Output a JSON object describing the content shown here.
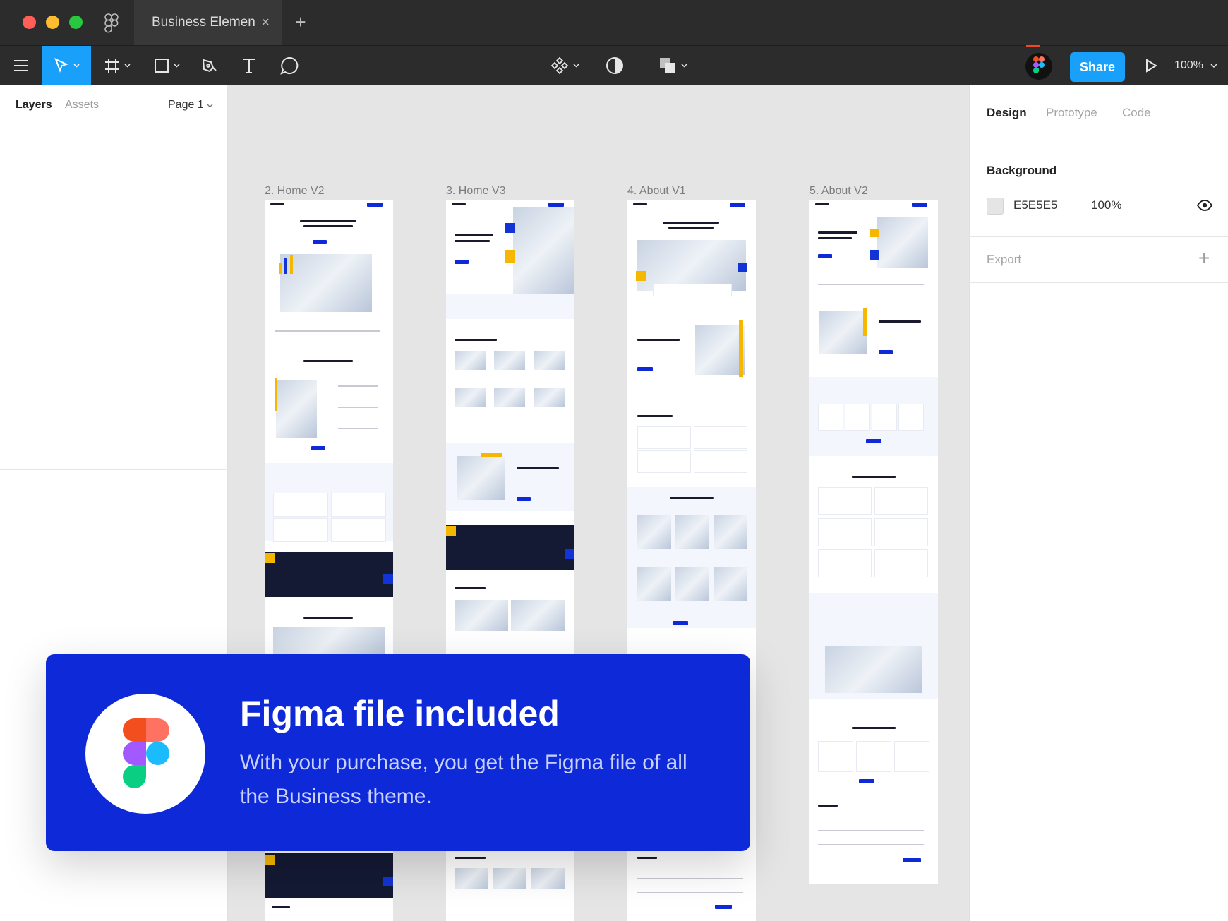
{
  "window": {
    "tab_title": "Business Elemen",
    "tab_close": "×",
    "new_tab": "+"
  },
  "toolbar": {
    "share_label": "Share",
    "zoom": "100%"
  },
  "left_panel": {
    "tabs": [
      "Layers",
      "Assets"
    ],
    "page_selector": "Page 1"
  },
  "right_panel": {
    "tabs": [
      "Design",
      "Prototype",
      "Code"
    ],
    "background_heading": "Background",
    "background_color": "E5E5E5",
    "background_opacity": "100%",
    "export_heading": "Export",
    "export_add": "+"
  },
  "canvas": {
    "frames": [
      {
        "label": "2. Home V2"
      },
      {
        "label": "3. Home V3"
      },
      {
        "label": "4. About V1"
      },
      {
        "label": "5. About V2"
      }
    ]
  },
  "banner": {
    "title": "Figma file included",
    "text": "With your purchase, you get the Figma file of all the Business theme."
  },
  "colors": {
    "accent": "#18a0fb",
    "banner": "#0e29d8",
    "canvas": "#e5e5e5",
    "toolbar": "#2c2c2c"
  }
}
